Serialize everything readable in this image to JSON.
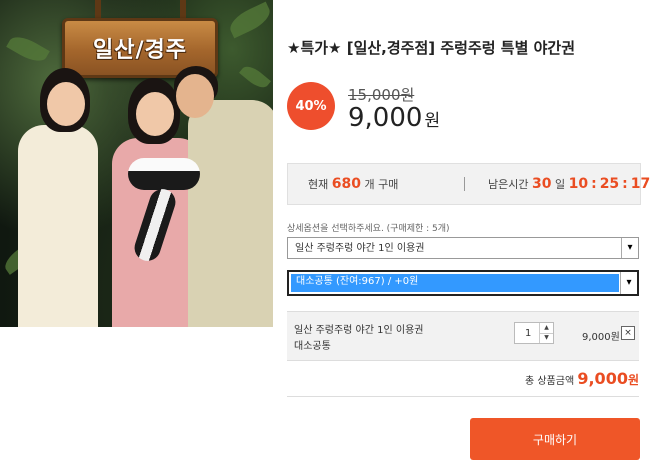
{
  "product": {
    "image_sign_text": "일산/경주",
    "title": "★특가★ [일산,경주점] 주렁주렁 특별 야간권",
    "discount": "40%",
    "original_price": "15,000원",
    "sale_price": "9,000",
    "sale_unit": "원"
  },
  "stats": {
    "current_label": "현재",
    "current_count": "680",
    "current_suffix": "개 구매",
    "remaining_label": "남은시간",
    "days": "30",
    "days_unit": "일",
    "hours": "10",
    "minutes": "25",
    "seconds": "17",
    "sep": ":"
  },
  "options": {
    "hint": "상세옵션을 선택하주세요. (구매제한 : 5개)",
    "select1_value": "일산 주렁주렁 야간 1인 이용권",
    "select2_value": "대소공통 (잔여:967) / +0원",
    "arrow": "▾"
  },
  "cart_item": {
    "name": "일산 주렁주렁 야간 1인 이용권",
    "option": "대소공통",
    "quantity": "1",
    "price": "9,000원",
    "remove": "×",
    "up": "▲",
    "down": "▼"
  },
  "total": {
    "label": "총 상품금액",
    "amount": "9,000",
    "unit": "원"
  },
  "buy_button": "구매하기"
}
